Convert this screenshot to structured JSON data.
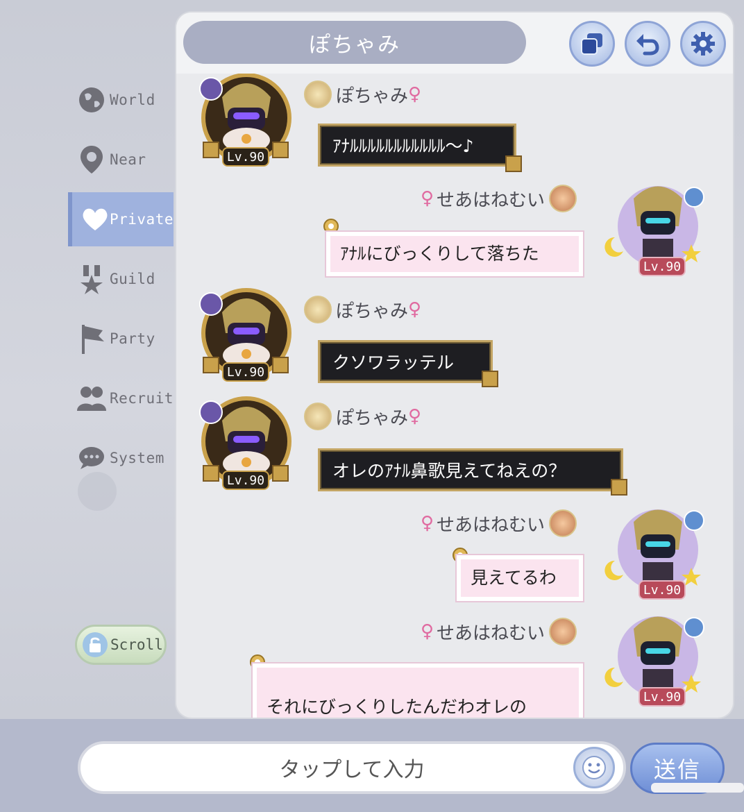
{
  "header": {
    "title": "ぽちゃみ",
    "buttons": [
      {
        "name": "window-icon"
      },
      {
        "name": "undo-icon"
      },
      {
        "name": "gear-icon"
      }
    ]
  },
  "sidebar": {
    "items": [
      {
        "label": "World",
        "icon": "globe-icon"
      },
      {
        "label": "Near",
        "icon": "location-pin-icon"
      },
      {
        "label": "Private",
        "icon": "heart-icon",
        "active": true
      },
      {
        "label": "Guild",
        "icon": "guild-emblem-icon"
      },
      {
        "label": "Party",
        "icon": "flag-icon"
      },
      {
        "label": "Recruit",
        "icon": "people-icon"
      },
      {
        "label": "System",
        "icon": "speech-bubble-icon"
      }
    ],
    "scroll_label": "Scroll"
  },
  "messages": [
    {
      "side": "left",
      "name": "ぽちゃみ",
      "text": "ｱﾅﾙﾙﾙﾙﾙﾙﾙﾙﾙﾙﾙ〜♪",
      "level": "Lv.90"
    },
    {
      "side": "right",
      "name": "せあはねむい",
      "text": "ｱﾅﾙにびっくりして落ちた",
      "level": "Lv.90"
    },
    {
      "side": "left",
      "name": "ぽちゃみ",
      "text": "クソワラッテル",
      "level": "Lv.90"
    },
    {
      "side": "left",
      "name": "ぽちゃみ",
      "text": "オレのｱﾅﾙ鼻歌見えてねえの？",
      "level": "Lv.90"
    },
    {
      "side": "right",
      "name": "せあはねむい",
      "text": "見えてるわ",
      "level": "Lv.90"
    },
    {
      "side": "right",
      "name": "せあはねむい",
      "text": "それにびっくりしたんだわオレの\nアカウントが",
      "level": "Lv.90"
    }
  ],
  "input": {
    "placeholder": "タップして入力",
    "send_label": "送信"
  },
  "colors": {
    "active_tab": "#9fb2de",
    "title_pill": "#a9aec3",
    "dark_bubble": "#1e1e22",
    "pink_bubble": "#fbe4ef",
    "send_button": "#6f8fd6"
  }
}
